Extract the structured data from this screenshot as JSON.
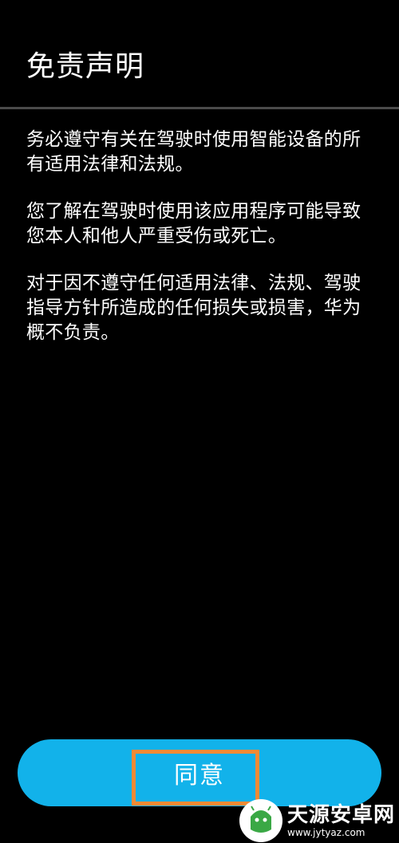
{
  "header": {
    "title": "免责声明"
  },
  "content": {
    "paragraphs": [
      "务必遵守有关在驾驶时使用智能设备的所有适用法律和法规。",
      "您了解在驾驶时使用该应用程序可能导致您本人和他人严重受伤或死亡。",
      "对于因不遵守任何适用法律、法规、驾驶指导方针所造成的任何损失或损害，华为概不负责。"
    ]
  },
  "actions": {
    "agree_label": "同意"
  },
  "watermark": {
    "title": "天源安卓网",
    "url": "www.jytyaz.com"
  },
  "colors": {
    "background": "#000000",
    "accent": "#12b2ea",
    "highlight": "#f08a35",
    "divider": "#4a4a4a"
  }
}
